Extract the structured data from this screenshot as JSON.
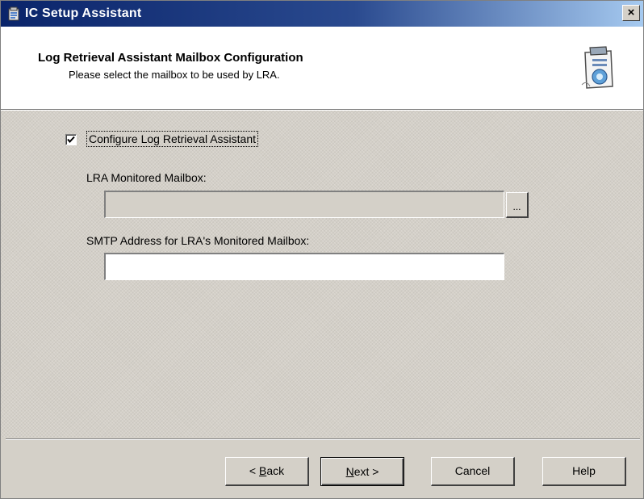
{
  "window": {
    "title": "IC Setup Assistant",
    "close_glyph": "×",
    "app_icon": "setup-icon"
  },
  "header": {
    "title": "Log Retrieval Assistant Mailbox Configuration",
    "subtitle": "Please select the mailbox to be used by LRA.",
    "icon": "wizard-icon"
  },
  "form": {
    "configure_checkbox": {
      "label": "Configure Log Retrieval Assistant",
      "checked": true
    },
    "mailbox": {
      "label": "LRA Monitored Mailbox:",
      "value": "",
      "enabled": false,
      "browse_label": "..."
    },
    "smtp": {
      "label": "SMTP Address for LRA's Monitored Mailbox:",
      "value": ""
    }
  },
  "buttons": {
    "back": {
      "prefix": "< ",
      "hotkey": "B",
      "rest": "ack"
    },
    "next": {
      "hotkey": "N",
      "rest": "ext >"
    },
    "cancel": "Cancel",
    "help": "Help"
  },
  "colors": {
    "titlebar_start": "#0a246a",
    "titlebar_end": "#a6caf0",
    "dialog_face": "#d4d0c8"
  }
}
